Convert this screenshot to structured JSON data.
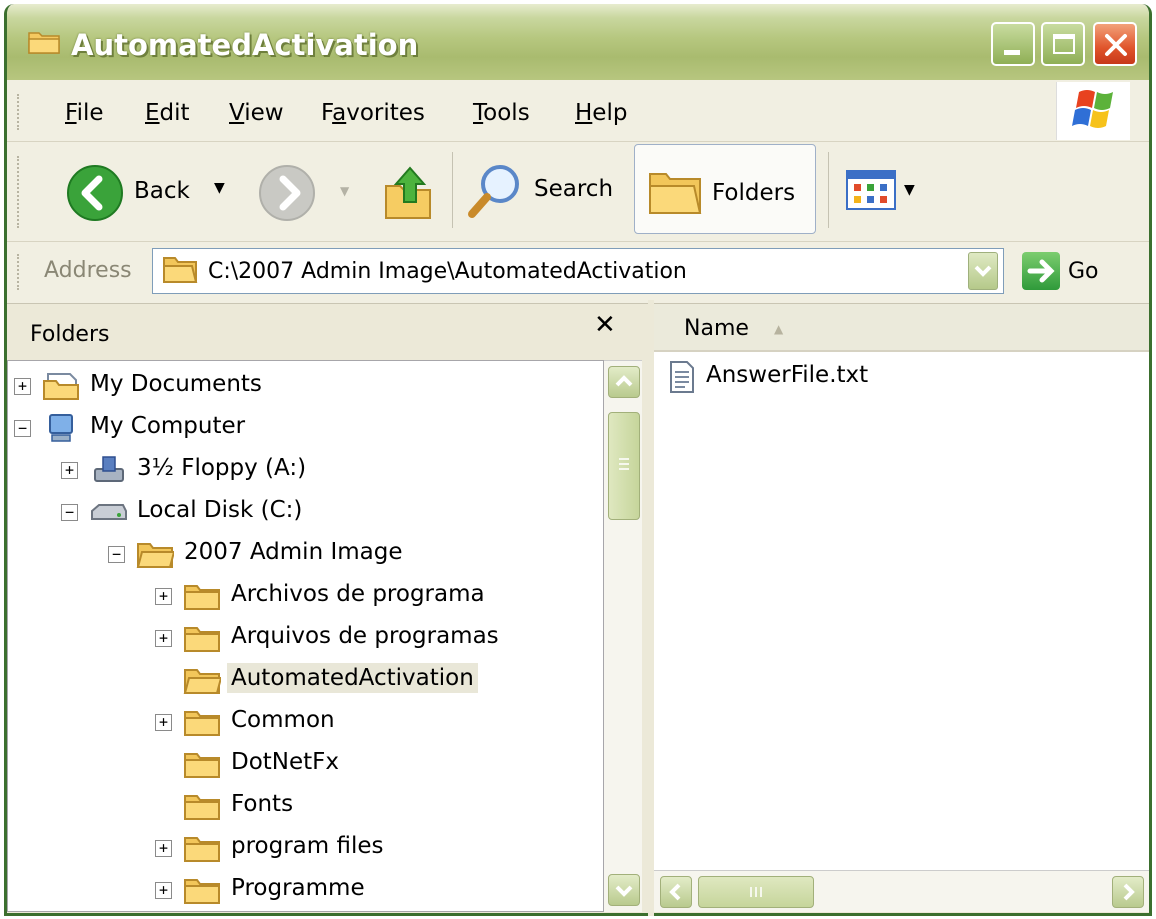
{
  "window": {
    "title": "AutomatedActivation"
  },
  "menu": {
    "items": [
      {
        "pre": "",
        "key": "F",
        "post": "ile"
      },
      {
        "pre": "",
        "key": "E",
        "post": "dit"
      },
      {
        "pre": "",
        "key": "V",
        "post": "iew"
      },
      {
        "pre": "F",
        "key": "a",
        "post": "vorites"
      },
      {
        "pre": "",
        "key": "T",
        "post": "ools"
      },
      {
        "pre": "",
        "key": "H",
        "post": "elp"
      }
    ]
  },
  "toolbar": {
    "back_label": "Back",
    "search_label": "Search",
    "folders_label": "Folders"
  },
  "address": {
    "label": "Address",
    "value": "C:\\2007 Admin Image\\AutomatedActivation",
    "go_label": "Go"
  },
  "folders_pane": {
    "title": "Folders",
    "close_glyph": "✕",
    "tree": [
      {
        "label": "My Documents",
        "expander": "+",
        "icon": "my-documents-icon"
      },
      {
        "label": "My Computer",
        "expander": "−",
        "icon": "my-computer-icon"
      },
      {
        "label": "3½ Floppy (A:)",
        "expander": "+",
        "icon": "floppy-drive-icon"
      },
      {
        "label": "Local Disk (C:)",
        "expander": "−",
        "icon": "hard-disk-icon"
      },
      {
        "label": "2007 Admin Image",
        "expander": "−",
        "icon": "folder-open-icon"
      },
      {
        "label": "Archivos de programa",
        "expander": "+",
        "icon": "folder-icon"
      },
      {
        "label": "Arquivos de programas",
        "expander": "+",
        "icon": "folder-icon"
      },
      {
        "label": "AutomatedActivation",
        "expander": "",
        "icon": "folder-open-icon",
        "selected": true
      },
      {
        "label": "Common",
        "expander": "+",
        "icon": "folder-icon"
      },
      {
        "label": "DotNetFx",
        "expander": "",
        "icon": "folder-icon"
      },
      {
        "label": "Fonts",
        "expander": "",
        "icon": "folder-icon"
      },
      {
        "label": "program files",
        "expander": "+",
        "icon": "folder-icon"
      },
      {
        "label": "Programme",
        "expander": "+",
        "icon": "folder-icon"
      }
    ]
  },
  "file_list": {
    "column_name": "Name",
    "files": [
      {
        "name": "AnswerFile.txt",
        "icon": "text-file-icon"
      }
    ]
  }
}
